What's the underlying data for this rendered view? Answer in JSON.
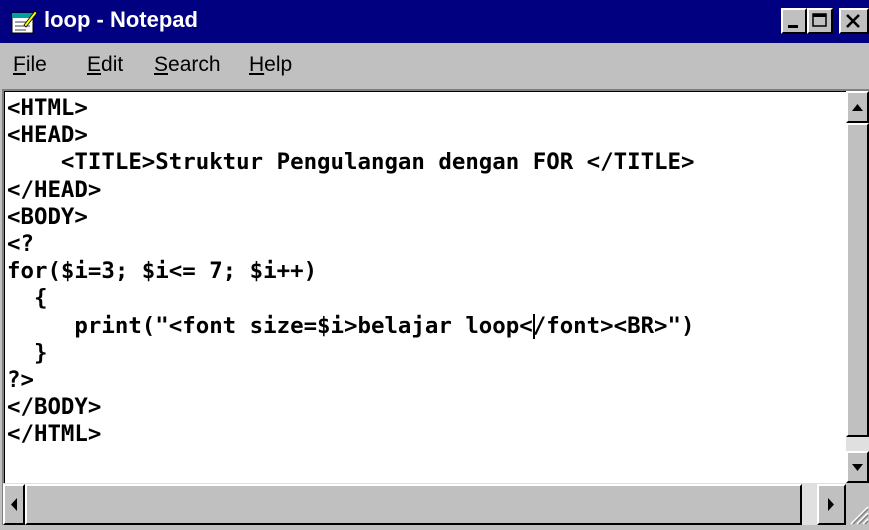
{
  "window": {
    "title": "loop - Notepad",
    "icon": "notepad-icon",
    "controls": [
      "minimize-icon",
      "maximize-icon",
      "close-icon"
    ]
  },
  "menu": {
    "items": [
      {
        "first": "F",
        "rest": "ile"
      },
      {
        "first": "E",
        "rest": "dit"
      },
      {
        "first": "S",
        "rest": "earch"
      },
      {
        "first": "H",
        "rest": "elp"
      }
    ]
  },
  "editor": {
    "lines": [
      "<HTML>",
      "<HEAD>",
      "    <TITLE>Struktur Pengulangan dengan FOR </TITLE>",
      "</HEAD>",
      "<BODY>",
      "<?",
      "for($i=3; $i<= 7; $i++)",
      "  {",
      "     print(\"<font size=$i>belajar loop</font><BR>\")",
      "  }",
      "?>",
      "</BODY>",
      "</HTML>"
    ],
    "caret": {
      "line": 9,
      "column": 39
    }
  },
  "colors": {
    "titlebar": "#000080",
    "face": "#c0c0c0",
    "text": "#000000"
  }
}
